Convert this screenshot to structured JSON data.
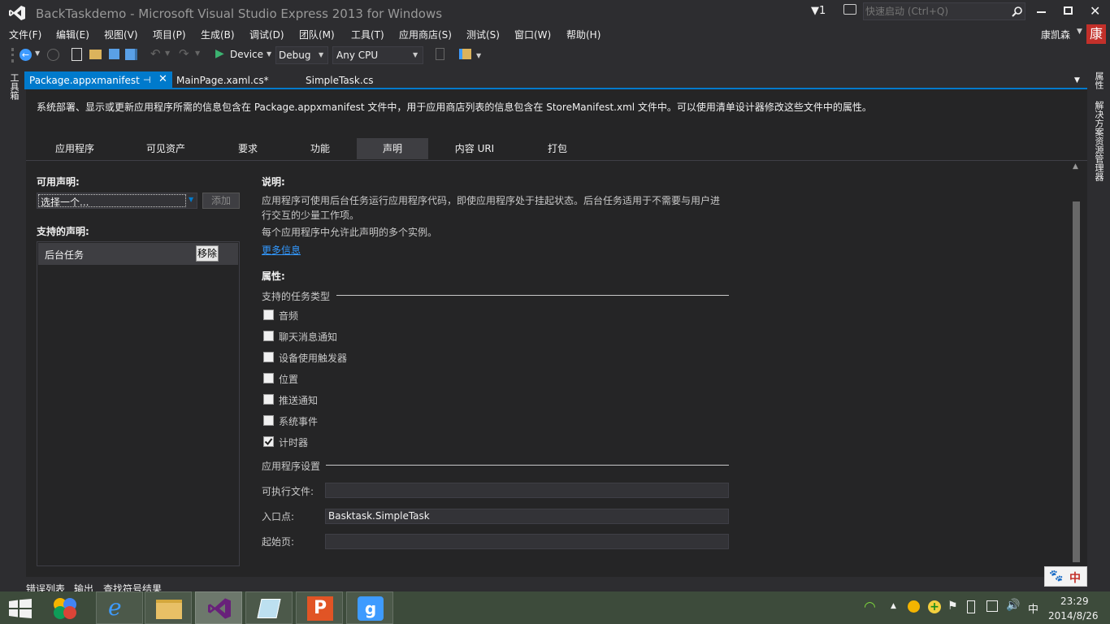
{
  "window": {
    "title": "BackTaskdemo - Microsoft Visual Studio Express 2013 for Windows",
    "notification_count": "1",
    "quick_launch_placeholder": "快速启动 (Ctrl+Q)",
    "user_name": "康凯森",
    "user_badge": "康"
  },
  "menu": [
    "文件(F)",
    "编辑(E)",
    "视图(V)",
    "项目(P)",
    "生成(B)",
    "调试(D)",
    "团队(M)",
    "工具(T)",
    "应用商店(S)",
    "测试(S)",
    "窗口(W)",
    "帮助(H)"
  ],
  "toolbar": {
    "run_target": "Device",
    "config": "Debug",
    "platform": "Any CPU"
  },
  "side_left": {
    "toolbox": "工具箱"
  },
  "side_right": {
    "properties": "属性",
    "solution_explorer": "解决方案资源管理器"
  },
  "doc_tabs": [
    {
      "label": "Package.appxmanifest",
      "active": true
    },
    {
      "label": "MainPage.xaml.cs*",
      "active": false
    },
    {
      "label": "SimpleTask.cs",
      "active": false
    }
  ],
  "manifest": {
    "intro": "系统部署、显示或更新应用程序所需的信息包含在 Package.appxmanifest 文件中，用于应用商店列表的信息包含在 StoreManifest.xml 文件中。可以使用清单设计器修改这些文件中的属性。",
    "tabs": [
      "应用程序",
      "可见资产",
      "要求",
      "功能",
      "声明",
      "内容 URI",
      "打包"
    ],
    "active_tab": "声明",
    "available_label": "可用声明:",
    "select_value": "选择一个...",
    "add_button": "添加",
    "supported_label": "支持的声明:",
    "supported_items": [
      {
        "name": "后台任务",
        "remove": "移除"
      }
    ],
    "description_label": "说明:",
    "description_text1": "应用程序可使用后台任务运行应用程序代码，即使应用程序处于挂起状态。后台任务适用于不需要与用户进",
    "description_text2": "行交互的少量工作项。",
    "multiple_text": "每个应用程序中允许此声明的多个实例。",
    "more_info": "更多信息",
    "properties_label": "属性:",
    "task_types_label": "支持的任务类型",
    "task_types": [
      {
        "label": "音频",
        "checked": false
      },
      {
        "label": "聊天消息通知",
        "checked": false
      },
      {
        "label": "设备使用触发器",
        "checked": false
      },
      {
        "label": "位置",
        "checked": false
      },
      {
        "label": "推送通知",
        "checked": false
      },
      {
        "label": "系统事件",
        "checked": false
      },
      {
        "label": "计时器",
        "checked": true
      }
    ],
    "app_settings_label": "应用程序设置",
    "exe_label": "可执行文件:",
    "exe_value": "",
    "entry_label": "入口点:",
    "entry_value": "Basktask.SimpleTask",
    "start_label": "起始页:",
    "start_value": ""
  },
  "bottom_tabs": [
    "错误列表",
    "输出",
    "查找符号结果"
  ],
  "ime": {
    "mode": "中"
  },
  "taskbar": {
    "time": "23:29",
    "date": "2014/8/26",
    "ime": "中"
  },
  "colors": {
    "accent": "#007acc",
    "background": "#2d2d30",
    "editor": "#252526",
    "link": "#3399ff",
    "taskbar": "#3d4b3b"
  }
}
